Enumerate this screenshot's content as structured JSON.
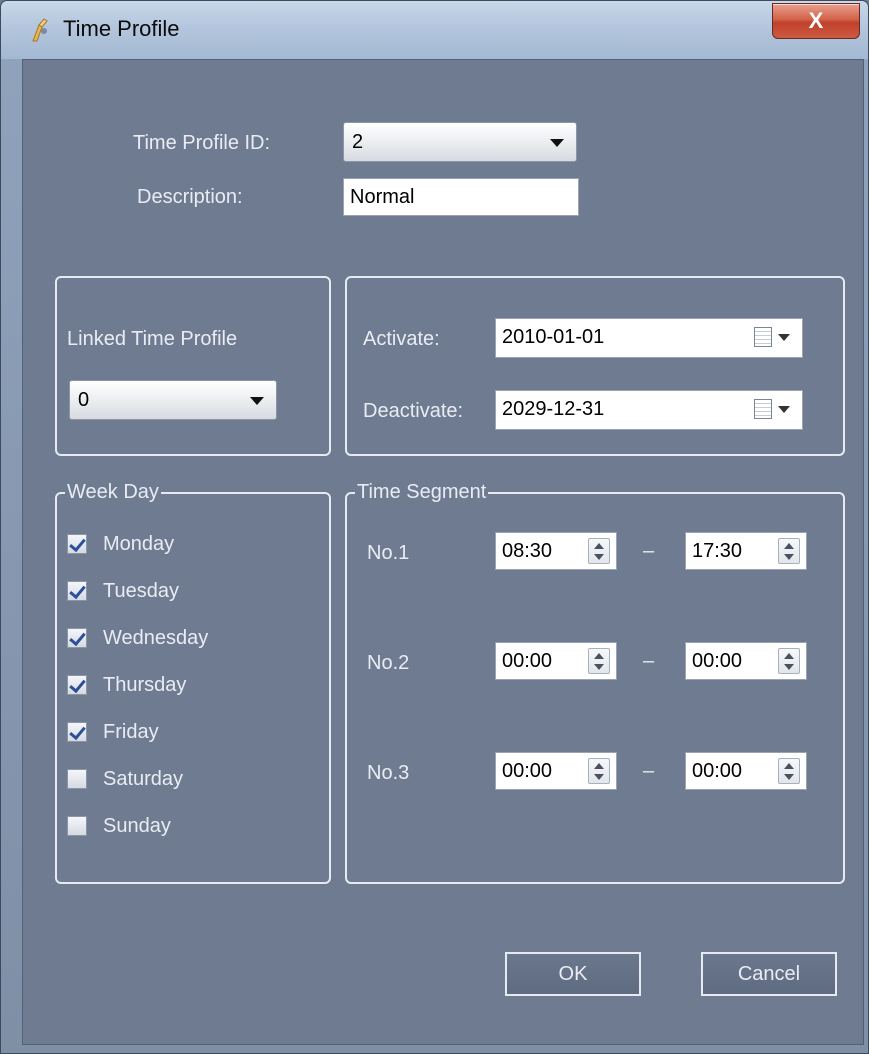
{
  "window": {
    "title": "Time Profile",
    "close_label": "X"
  },
  "header": {
    "id_label": "Time Profile ID:",
    "id_value": "2",
    "desc_label": "Description:",
    "desc_value": "Normal"
  },
  "linked": {
    "label": "Linked Time Profile",
    "value": "0"
  },
  "dates": {
    "activate_label": "Activate:",
    "activate_value": "2010-01-01",
    "deactivate_label": "Deactivate:",
    "deactivate_value": "2029-12-31"
  },
  "weekday": {
    "legend": "Week Day",
    "days": [
      {
        "label": "Monday",
        "checked": true
      },
      {
        "label": "Tuesday",
        "checked": true
      },
      {
        "label": "Wednesday",
        "checked": true
      },
      {
        "label": "Thursday",
        "checked": true
      },
      {
        "label": "Friday",
        "checked": true
      },
      {
        "label": "Saturday",
        "checked": false
      },
      {
        "label": "Sunday",
        "checked": false
      }
    ]
  },
  "segments": {
    "legend": "Time Segment",
    "dash": "–",
    "rows": [
      {
        "label": "No.1",
        "start": "08:30",
        "end": "17:30"
      },
      {
        "label": "No.2",
        "start": "00:00",
        "end": "00:00"
      },
      {
        "label": "No.3",
        "start": "00:00",
        "end": "00:00"
      }
    ]
  },
  "buttons": {
    "ok": "OK",
    "cancel": "Cancel"
  },
  "colors": {
    "client_bg": "#6f7b91",
    "close_red": "#c1402a",
    "text_light": "#e9edf3",
    "check_blue": "#2c4f9a"
  }
}
